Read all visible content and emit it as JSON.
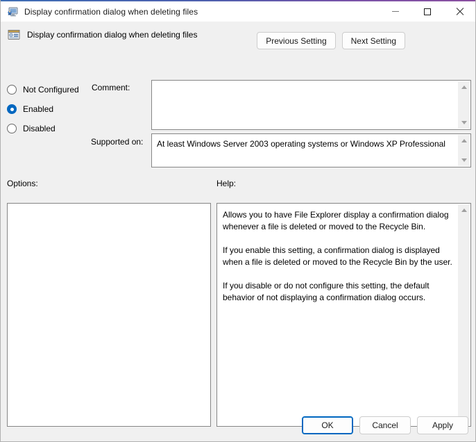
{
  "titlebar": {
    "title": "Display confirmation dialog when deleting files",
    "icon": "group-policy-computer-icon",
    "minimize_label": "Minimize",
    "maximize_label": "Maximize",
    "close_label": "Close"
  },
  "header": {
    "setting_title": "Display confirmation dialog when deleting files",
    "setting_icon": "policy-setting-icon",
    "previous_setting_label": "Previous Setting",
    "next_setting_label": "Next Setting"
  },
  "state": {
    "options": [
      {
        "label": "Not Configured",
        "checked": false
      },
      {
        "label": "Enabled",
        "checked": true
      },
      {
        "label": "Disabled",
        "checked": false
      }
    ]
  },
  "comment": {
    "label": "Comment:",
    "value": "",
    "placeholder": ""
  },
  "supported_on": {
    "label": "Supported on:",
    "value": "At least Windows Server 2003 operating systems or Windows XP Professional"
  },
  "options_panel": {
    "label": "Options:",
    "value": ""
  },
  "help_panel": {
    "label": "Help:",
    "text": "Allows you to have File Explorer display a confirmation dialog whenever a file is deleted or moved to the Recycle Bin.\n\nIf you enable this setting, a confirmation dialog is displayed when a file is deleted or moved to the Recycle Bin by the user.\n\nIf you disable or do not configure this setting, the default behavior of not displaying a confirmation dialog occurs."
  },
  "footer": {
    "ok_label": "OK",
    "cancel_label": "Cancel",
    "apply_label": "Apply"
  },
  "colors": {
    "accent": "#0067c0",
    "window_bg": "#f0f0f0",
    "field_bg": "#ffffff",
    "border": "#868686",
    "titlebar_bg": "#ffffff"
  }
}
